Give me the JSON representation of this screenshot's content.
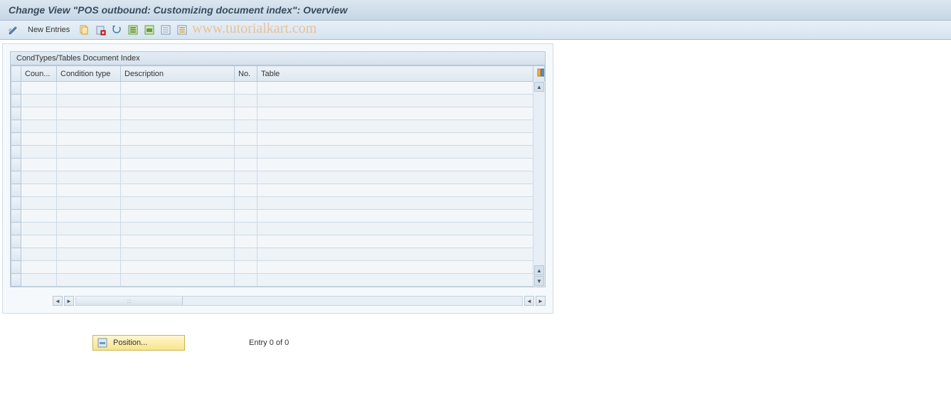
{
  "title": "Change View \"POS outbound: Customizing document index\": Overview",
  "toolbar": {
    "new_entries": "New Entries"
  },
  "watermark": "www.tutorialkart.com",
  "panel": {
    "title": "CondTypes/Tables Document Index",
    "columns": [
      "Coun...",
      "Condition type",
      "Description",
      "No.",
      "Table"
    ],
    "rows": [
      [
        "",
        "",
        "",
        "",
        ""
      ],
      [
        "",
        "",
        "",
        "",
        ""
      ],
      [
        "",
        "",
        "",
        "",
        ""
      ],
      [
        "",
        "",
        "",
        "",
        ""
      ],
      [
        "",
        "",
        "",
        "",
        ""
      ],
      [
        "",
        "",
        "",
        "",
        ""
      ],
      [
        "",
        "",
        "",
        "",
        ""
      ],
      [
        "",
        "",
        "",
        "",
        ""
      ],
      [
        "",
        "",
        "",
        "",
        ""
      ],
      [
        "",
        "",
        "",
        "",
        ""
      ],
      [
        "",
        "",
        "",
        "",
        ""
      ],
      [
        "",
        "",
        "",
        "",
        ""
      ],
      [
        "",
        "",
        "",
        "",
        ""
      ],
      [
        "",
        "",
        "",
        "",
        ""
      ],
      [
        "",
        "",
        "",
        "",
        ""
      ],
      [
        "",
        "",
        "",
        "",
        ""
      ]
    ]
  },
  "footer": {
    "position_label": "Position...",
    "entry_text": "Entry 0 of 0"
  }
}
